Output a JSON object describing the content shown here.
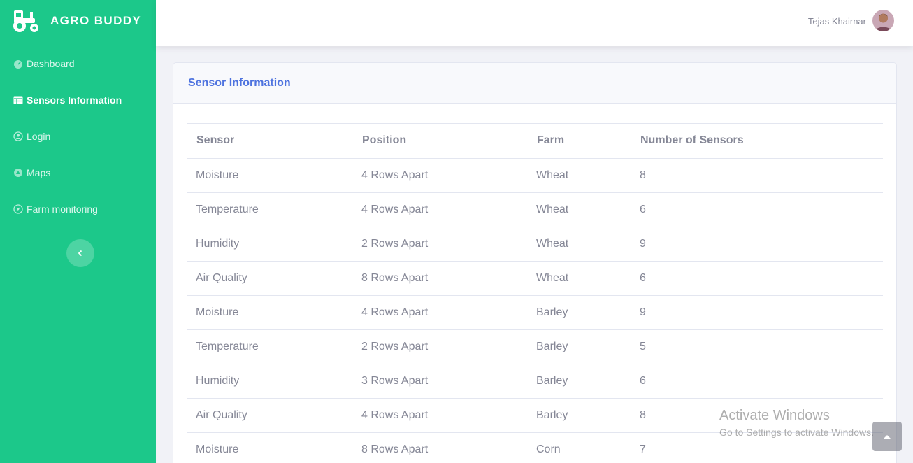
{
  "brand": {
    "name": "AGRO BUDDY",
    "icon": "tractor-icon"
  },
  "nav": {
    "items": [
      {
        "label": "Dashboard",
        "icon": "speedometer-icon",
        "active": false
      },
      {
        "label": "Sensors Information",
        "icon": "table-icon",
        "active": true
      },
      {
        "label": "Login",
        "icon": "user-circle-icon",
        "active": false
      },
      {
        "label": "Maps",
        "icon": "map-icon",
        "active": false
      },
      {
        "label": "Farm monitoring",
        "icon": "compass-icon",
        "active": false
      }
    ],
    "toggle_icon": "chevron-left-icon"
  },
  "topbar": {
    "user_name": "Tejas Khairnar"
  },
  "card": {
    "title": "Sensor Information"
  },
  "table": {
    "headers": [
      "Sensor",
      "Position",
      "Farm",
      "Number of Sensors"
    ],
    "rows": [
      [
        "Moisture",
        "4 Rows Apart",
        "Wheat",
        "8"
      ],
      [
        "Temperature",
        "4 Rows Apart",
        "Wheat",
        "6"
      ],
      [
        "Humidity",
        "2 Rows Apart",
        "Wheat",
        "9"
      ],
      [
        "Air Quality",
        "8 Rows Apart",
        "Wheat",
        "6"
      ],
      [
        "Moisture",
        "4 Rows Apart",
        "Barley",
        "9"
      ],
      [
        "Temperature",
        "2 Rows Apart",
        "Barley",
        "5"
      ],
      [
        "Humidity",
        "3 Rows Apart",
        "Barley",
        "6"
      ],
      [
        "Air Quality",
        "4 Rows Apart",
        "Barley",
        "8"
      ],
      [
        "Moisture",
        "8 Rows Apart",
        "Corn",
        "7"
      ]
    ]
  },
  "watermark": {
    "line1": "Activate Windows",
    "line2": "Go to Settings to activate Windows."
  },
  "colors": {
    "sidebar": "#1cc88a",
    "accent": "#4e73df",
    "text_muted": "#858796"
  }
}
